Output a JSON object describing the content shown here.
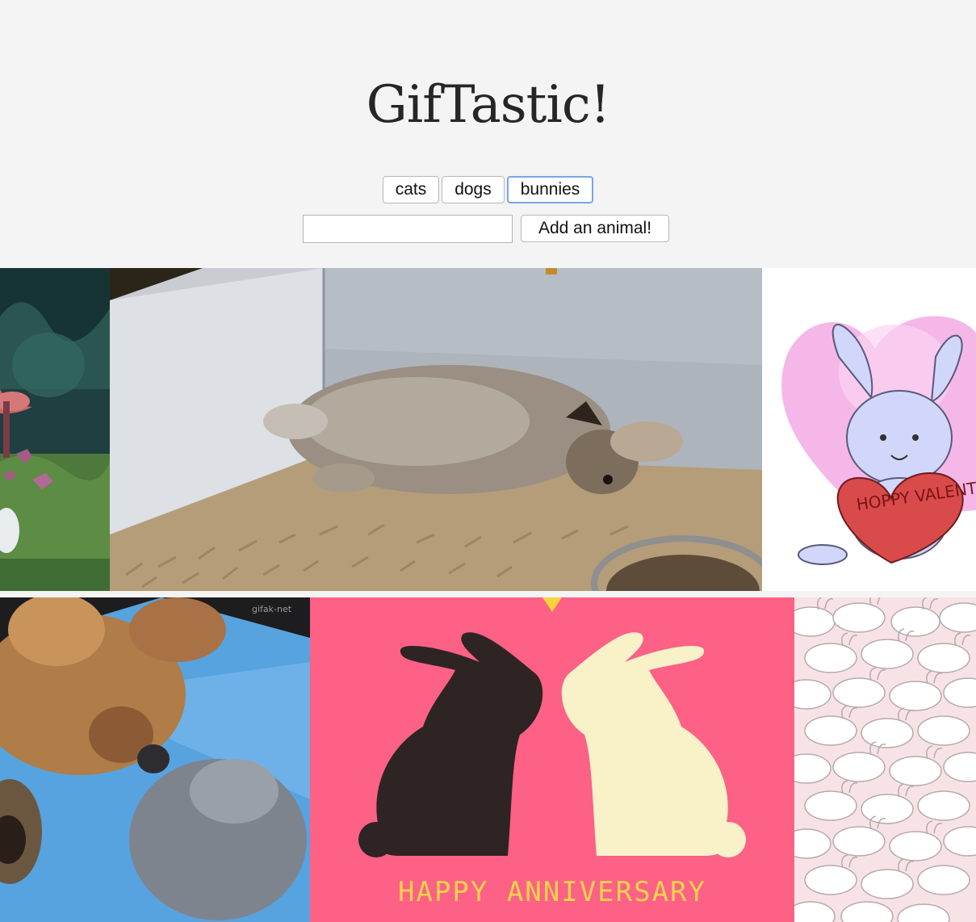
{
  "app": {
    "title": "GifTastic!"
  },
  "animal_buttons": [
    {
      "label": "cats",
      "active": false
    },
    {
      "label": "dogs",
      "active": false
    },
    {
      "label": "bunnies",
      "active": true
    }
  ],
  "add_form": {
    "input_value": "",
    "input_placeholder": "",
    "submit_label": "Add an animal!"
  },
  "gifs": [
    {
      "subject": "cartoon forest scene",
      "caption": ""
    },
    {
      "subject": "rabbit lying in box",
      "caption": ""
    },
    {
      "subject": "cartoon bunny holding heart",
      "caption": "HOPPY VALENTINE'S DAY!"
    },
    {
      "subject": "two rabbits nose to nose",
      "caption": "gifak-net"
    },
    {
      "subject": "two bunny silhouettes",
      "caption": "HAPPY ANNIVERSARY"
    },
    {
      "subject": "pile of cartoon bunnies",
      "caption": ""
    }
  ],
  "colors": {
    "page_bg": "#f4f4f4",
    "title_text": "#262626",
    "active_border": "#7aa6e8",
    "anniversary_bg": "#fd6185",
    "anniversary_text": "#f5d24c"
  }
}
